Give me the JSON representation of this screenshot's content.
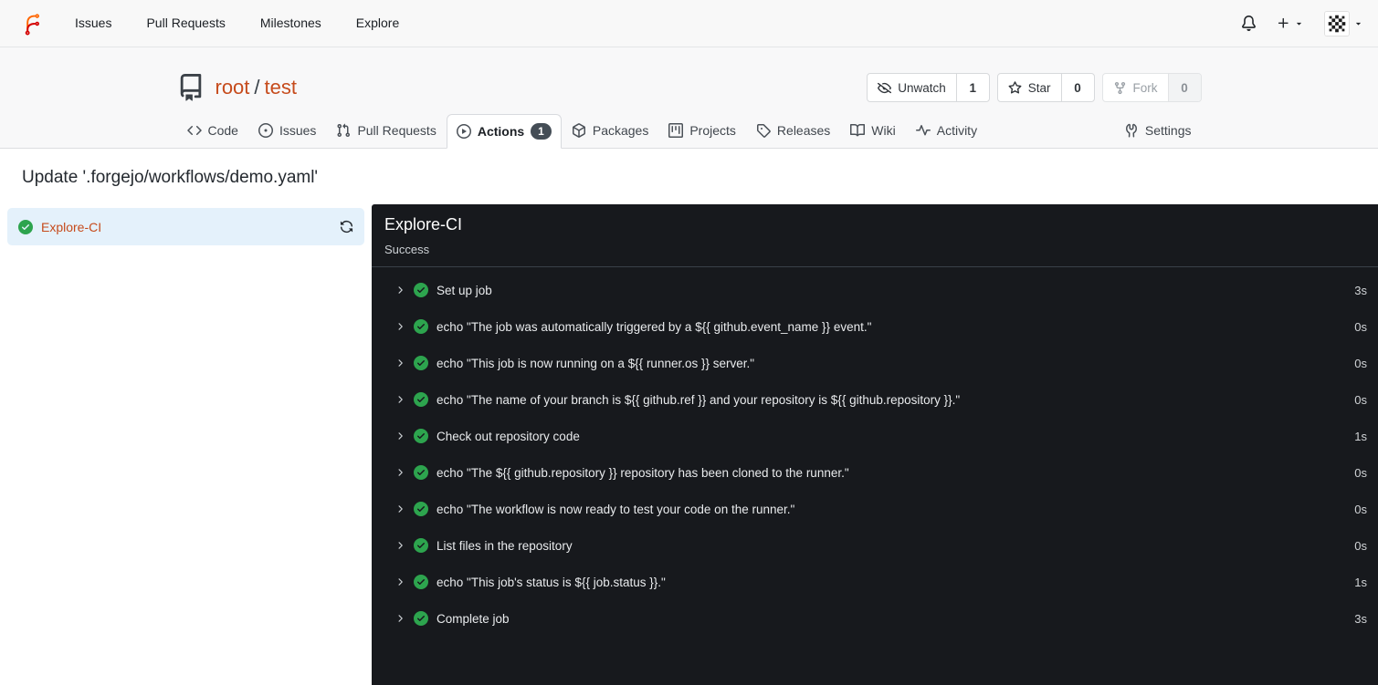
{
  "navbar": {
    "links": [
      {
        "label": "Issues"
      },
      {
        "label": "Pull Requests"
      },
      {
        "label": "Milestones"
      },
      {
        "label": "Explore"
      }
    ]
  },
  "repo": {
    "owner": "root",
    "separator": "/",
    "name": "test",
    "actions": {
      "unwatch": {
        "label": "Unwatch",
        "count": "1"
      },
      "star": {
        "label": "Star",
        "count": "0"
      },
      "fork": {
        "label": "Fork",
        "count": "0"
      }
    },
    "tabs": [
      {
        "label": "Code"
      },
      {
        "label": "Issues"
      },
      {
        "label": "Pull Requests"
      },
      {
        "label": "Actions",
        "badge": "1"
      },
      {
        "label": "Packages"
      },
      {
        "label": "Projects"
      },
      {
        "label": "Releases"
      },
      {
        "label": "Wiki"
      },
      {
        "label": "Activity"
      }
    ],
    "settings_tab": {
      "label": "Settings"
    }
  },
  "page": {
    "title": "Update '.forgejo/workflows/demo.yaml'"
  },
  "run": {
    "job": {
      "name": "Explore-CI"
    },
    "selected_job": {
      "title": "Explore-CI",
      "status_text": "Success",
      "steps": [
        {
          "name": "Set up job",
          "duration": "3s"
        },
        {
          "name": "echo \"The job was automatically triggered by a ${{ github.event_name }} event.\"",
          "duration": "0s"
        },
        {
          "name": "echo \"This job is now running on a ${{ runner.os }} server.\"",
          "duration": "0s"
        },
        {
          "name": "echo \"The name of your branch is ${{ github.ref }} and your repository is ${{ github.repository }}.\"",
          "duration": "0s"
        },
        {
          "name": "Check out repository code",
          "duration": "1s"
        },
        {
          "name": "echo \"The ${{ github.repository }} repository has been cloned to the runner.\"",
          "duration": "0s"
        },
        {
          "name": "echo \"The workflow is now ready to test your code on the runner.\"",
          "duration": "0s"
        },
        {
          "name": "List files in the repository",
          "duration": "0s"
        },
        {
          "name": "echo \"This job's status is ${{ job.status }}.\"",
          "duration": "1s"
        },
        {
          "name": "Complete job",
          "duration": "3s"
        }
      ]
    }
  },
  "colors": {
    "accent_link": "#c64b1c",
    "success_green": "#2da44e",
    "panel_background": "#17191d",
    "selected_job_background": "#e4f1fb"
  }
}
